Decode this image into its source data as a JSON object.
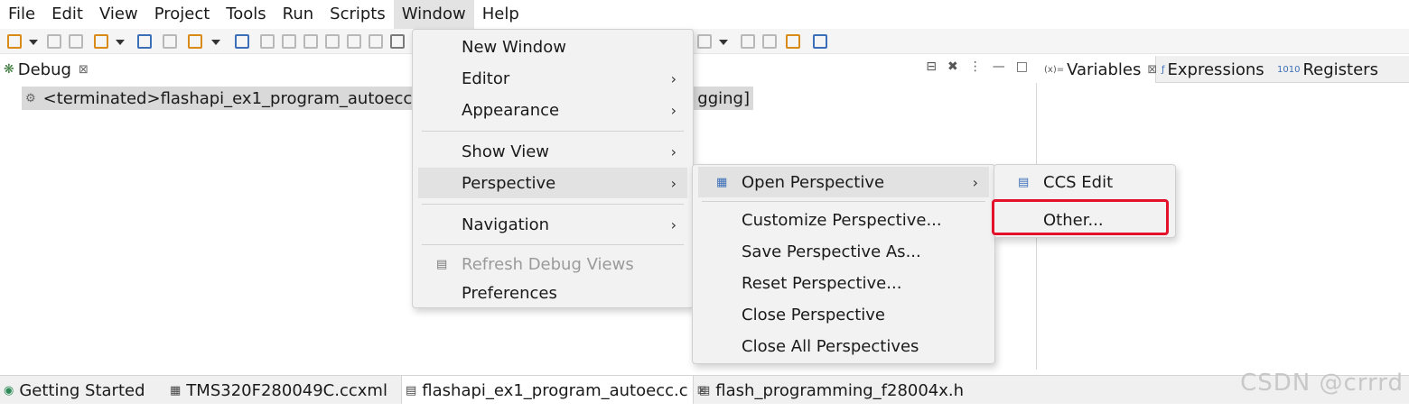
{
  "menubar": {
    "items": [
      "File",
      "Edit",
      "View",
      "Project",
      "Tools",
      "Run",
      "Scripts",
      "Window",
      "Help"
    ],
    "active": "Window"
  },
  "debug_view": {
    "title": "Debug",
    "row_text": "<terminated>flashapi_ex1_program_autoecc [C",
    "row_text_tail": "gging]"
  },
  "right_panel": {
    "tabs": [
      "Variables",
      "Expressions",
      "Registers"
    ],
    "icons": [
      "(x)=",
      "ƒ",
      "1010"
    ]
  },
  "window_menu": {
    "items": [
      {
        "label": "New Window",
        "submenu": false
      },
      {
        "label": "Editor",
        "submenu": true
      },
      {
        "label": "Appearance",
        "submenu": true
      },
      {
        "label": "Show View",
        "submenu": true
      },
      {
        "label": "Perspective",
        "submenu": true
      },
      {
        "label": "Navigation",
        "submenu": true
      },
      {
        "label": "Refresh Debug Views",
        "submenu": false,
        "disabled": true
      },
      {
        "label": "Preferences",
        "submenu": false
      }
    ]
  },
  "perspective_menu": {
    "items": [
      {
        "label": "Open Perspective",
        "submenu": true
      },
      {
        "label": "Customize Perspective..."
      },
      {
        "label": "Save Perspective As..."
      },
      {
        "label": "Reset Perspective..."
      },
      {
        "label": "Close Perspective"
      },
      {
        "label": "Close All Perspectives"
      }
    ]
  },
  "open_perspective_menu": {
    "items": [
      {
        "label": "CCS Edit"
      },
      {
        "label": "Other..."
      }
    ],
    "annotation_color": "#e3122a"
  },
  "editor_tabs": [
    {
      "label": "Getting Started"
    },
    {
      "label": "TMS320F280049C.ccxml"
    },
    {
      "label": "flashapi_ex1_program_autoecc.c",
      "selected": true
    },
    {
      "label": "flash_programming_f28004x.h"
    }
  ],
  "watermark": "CSDN @crrrd"
}
